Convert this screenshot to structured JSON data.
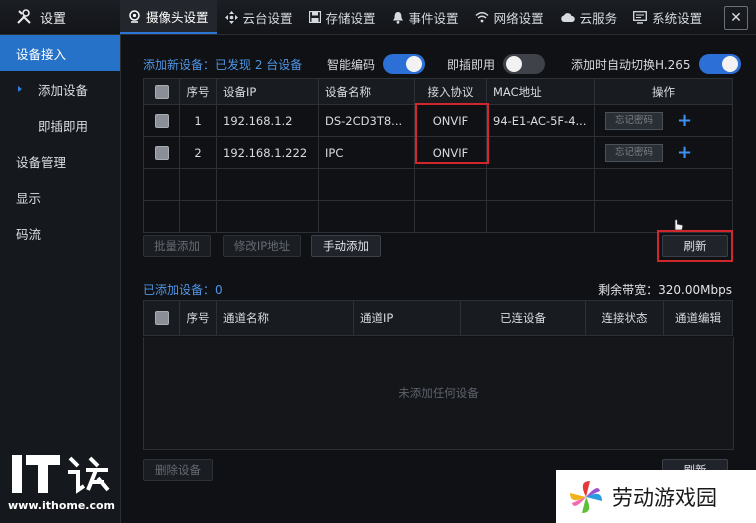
{
  "app": {
    "title": "设置"
  },
  "tabs": [
    {
      "label": "摄像头设置",
      "active": true
    },
    {
      "label": "云台设置"
    },
    {
      "label": "存储设置"
    },
    {
      "label": "事件设置"
    },
    {
      "label": "网络设置"
    },
    {
      "label": "云服务"
    },
    {
      "label": "系统设置"
    }
  ],
  "sidebar": {
    "items": [
      {
        "label": "设备接入",
        "active": true
      },
      {
        "label": "添加设备"
      },
      {
        "label": "即插即用"
      },
      {
        "label": "设备管理"
      },
      {
        "label": "显示"
      },
      {
        "label": "码流"
      }
    ]
  },
  "add_device": {
    "found_label": "添加新设备：已发现 2 台设备",
    "smart_encode": {
      "label": "智能编码",
      "on": true
    },
    "plug_play": {
      "label": "即插即用",
      "on": false
    },
    "auto_h265": {
      "label": "添加时自动切换H.265",
      "on": true
    },
    "columns": [
      "序号",
      "设备IP",
      "设备名称",
      "接入协议",
      "MAC地址",
      "操作"
    ],
    "rows": [
      {
        "index": "1",
        "ip": "192.168.1.2",
        "name": "DS-2CD3T8...",
        "protocol": "ONVIF",
        "mac": "94-E1-AC-5F-4...",
        "forgot": "忘记密码"
      },
      {
        "index": "2",
        "ip": "192.168.1.222",
        "name": "IPC",
        "protocol": "ONVIF",
        "mac": "",
        "forgot": "忘记密码"
      }
    ],
    "buttons": {
      "batch_add": "批量添加",
      "modify_ip": "修改IP地址",
      "manual_add": "手动添加",
      "refresh": "刷新"
    }
  },
  "added_device": {
    "title": "已添加设备：0",
    "bandwidth": "剩余带宽：320.00Mbps",
    "columns": [
      "序号",
      "通道名称",
      "通道IP",
      "已连设备",
      "连接状态",
      "通道编辑"
    ],
    "empty": "未添加任何设备",
    "buttons": {
      "delete": "删除设备",
      "refresh": "刷新"
    }
  },
  "logo": {
    "text": "IT之家",
    "url": "www.ithome.com"
  },
  "watermark": {
    "text": "劳动游戏园"
  },
  "colors": {
    "accent": "#2672c9",
    "highlight": "#d0262c"
  }
}
